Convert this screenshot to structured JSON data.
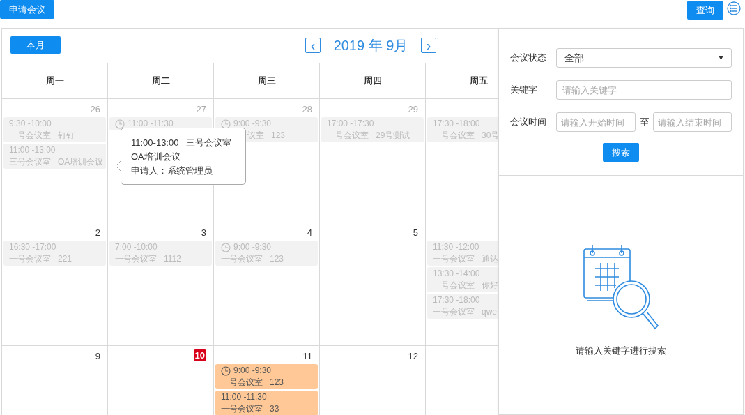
{
  "toolbar": {
    "apply_button": "申请会议",
    "query_button": "查询"
  },
  "calendar": {
    "today_button": "本月",
    "prev": "‹",
    "title": "2019 年 9月",
    "next": "›",
    "weekdays": [
      "周一",
      "周二",
      "周三",
      "周四",
      "周五"
    ],
    "weeks": [
      [
        {
          "day": "26",
          "other_month": true,
          "today": false,
          "events": [
            {
              "time": "9:30 -10:00",
              "detail": "一号会议室   钉钉",
              "past": true,
              "clock": false
            },
            {
              "time": "11:00 -13:00",
              "detail": "三号会议室   OA培训会议",
              "past": true,
              "clock": false
            }
          ]
        },
        {
          "day": "27",
          "other_month": true,
          "today": false,
          "events": [
            {
              "time": "11:00 -11:30",
              "past": true,
              "clock": true
            }
          ]
        },
        {
          "day": "28",
          "other_month": true,
          "today": false,
          "events": [
            {
              "time": "9:00 -9:30",
              "detail": "议室   123",
              "past": true,
              "clock": true,
              "covered": true
            }
          ]
        },
        {
          "day": "29",
          "other_month": true,
          "today": false,
          "events": [
            {
              "time": "17:00 -17:30",
              "detail": "一号会议室   29号测试",
              "past": true,
              "clock": false
            }
          ]
        },
        {
          "events": [
            {
              "time": "17:30 -18:00",
              "detail": "一号会议室   30号",
              "past": true,
              "clock": false
            }
          ]
        }
      ],
      [
        {
          "day": "2",
          "other_month": false,
          "today": false,
          "events": [
            {
              "time": "16:30 -17:00",
              "detail": "一号会议室   221",
              "past": true,
              "clock": false
            }
          ]
        },
        {
          "day": "3",
          "other_month": false,
          "today": false,
          "events": [
            {
              "time": "7:00 -10:00",
              "detail": "一号会议室   1112",
              "past": true,
              "clock": false
            }
          ]
        },
        {
          "day": "4",
          "other_month": false,
          "today": false,
          "events": [
            {
              "time": "9:00 -9:30",
              "detail": "一号会议室   123",
              "past": true,
              "clock": true
            }
          ]
        },
        {
          "day": "5",
          "other_month": false,
          "today": false
        },
        {
          "events": [
            {
              "time": "11:30 -12:00",
              "detail": "一号会议室   通达",
              "past": true,
              "clock": false
            },
            {
              "time": "13:30 -14:00",
              "detail": "一号会议室   你好",
              "past": true,
              "clock": false
            },
            {
              "time": "17:30 -18:00",
              "detail": "一号会议室   qwe",
              "past": true,
              "clock": false
            }
          ]
        }
      ],
      [
        {
          "day": "9",
          "other_month": false,
          "today": false
        },
        {
          "day": "10",
          "other_month": false,
          "today": true
        },
        {
          "day": "11",
          "other_month": false,
          "today": false,
          "events": [
            {
              "time": "9:00 -9:30",
              "detail": "一号会议室   123",
              "past": false,
              "clock": true
            },
            {
              "time": "11:00 -11:30",
              "detail": "一号会议室   33",
              "past": false,
              "clock": false
            }
          ]
        },
        {
          "day": "12",
          "other_month": false,
          "today": false
        }
      ]
    ]
  },
  "tooltip": {
    "line_1": "11:00-13:00   三号会议室",
    "line_2": "OA培训会议",
    "line_3": "申请人：系统管理员"
  },
  "search_panel": {
    "status_label": "会议状态",
    "status_value": "全部",
    "keyword_label": "关键字",
    "keyword_placeholder": "请输入关键字",
    "time_label": "会议时间",
    "start_placeholder": "请输入开始时间",
    "to": "至",
    "end_placeholder": "请输入结束时间",
    "search_button": "搜索",
    "empty_text": "请输入关键字进行搜索"
  }
}
